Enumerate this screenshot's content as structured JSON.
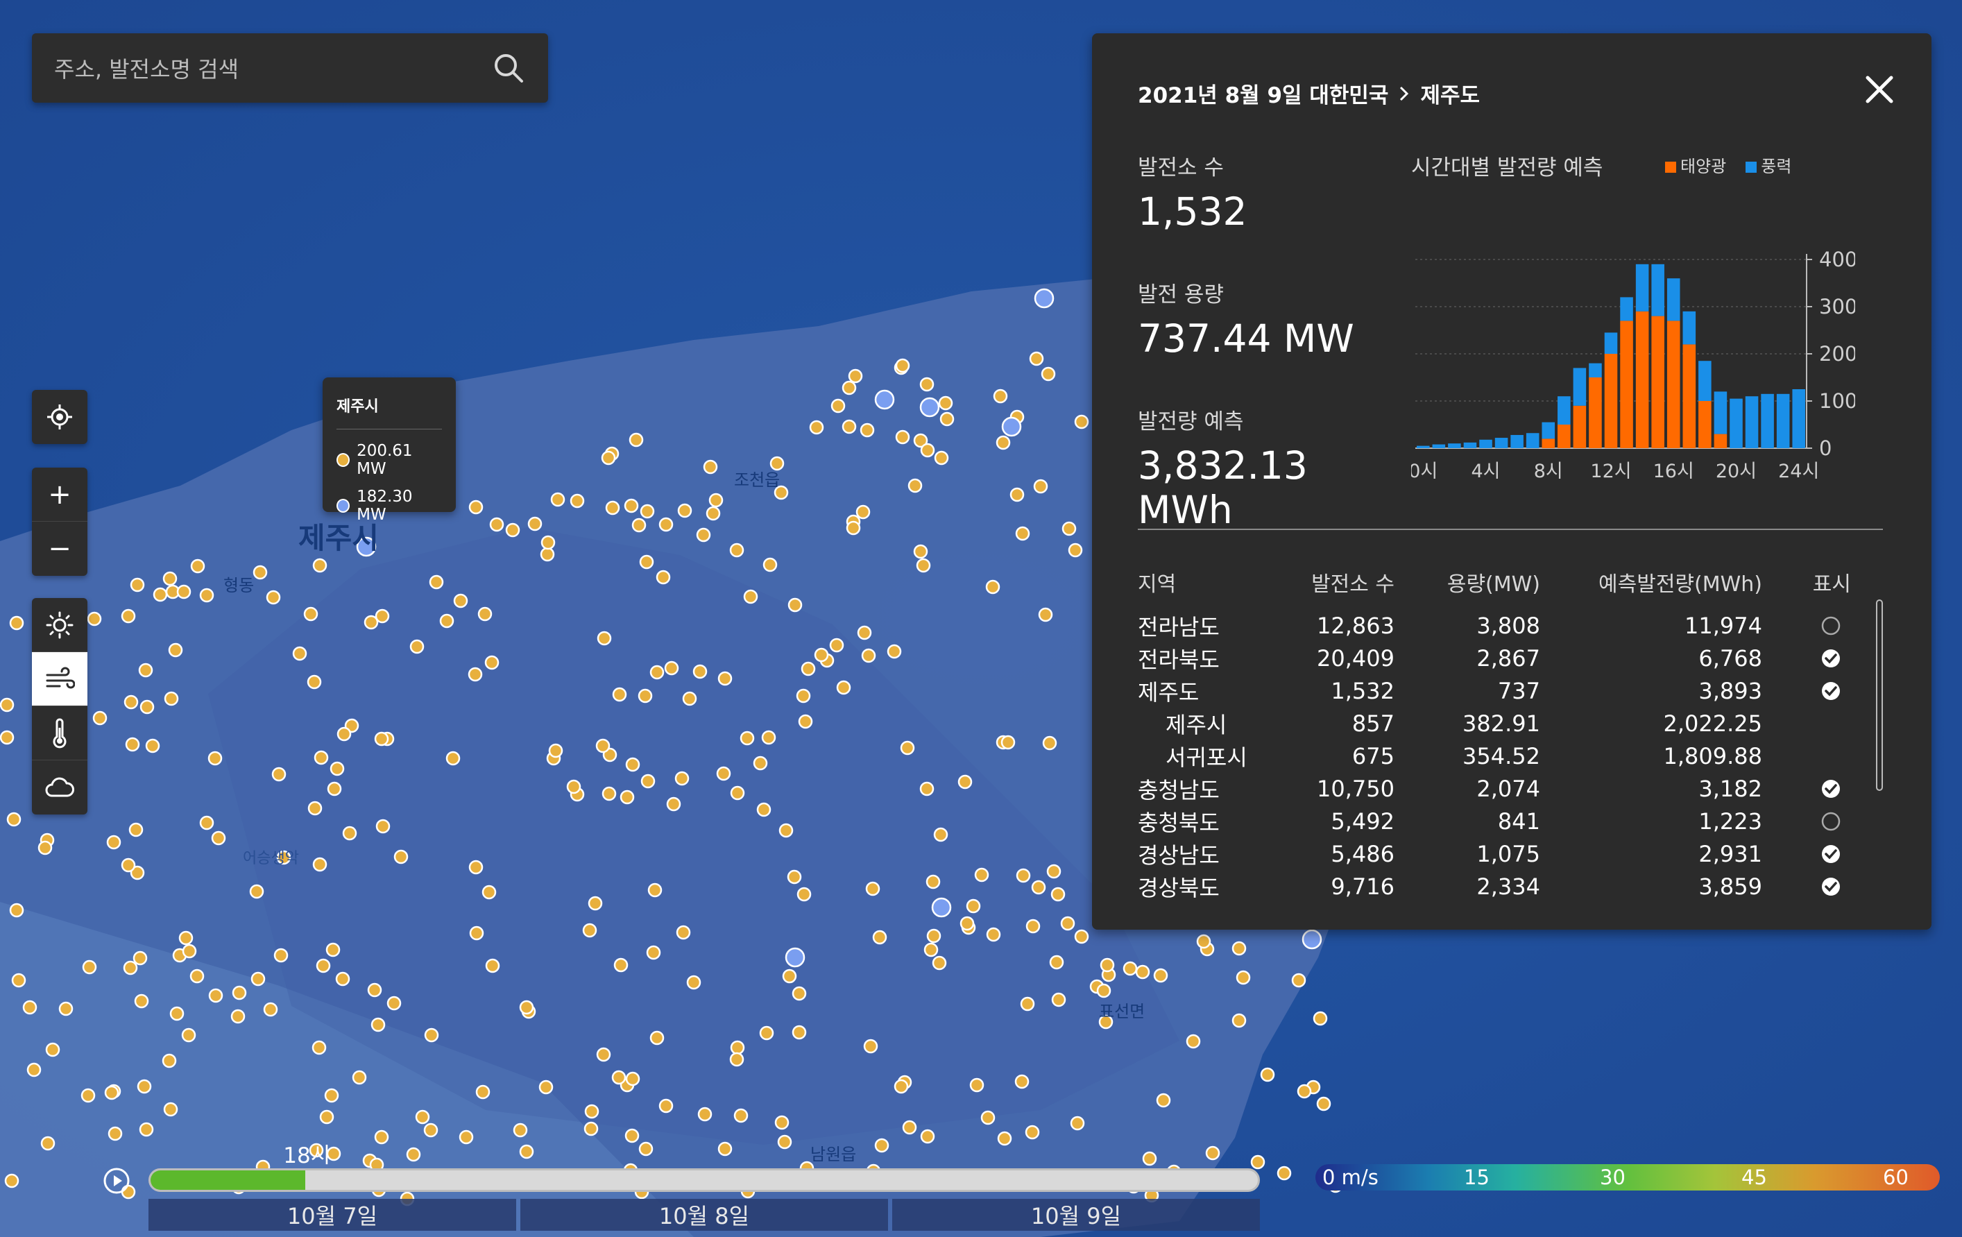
{
  "search": {
    "placeholder": "주소, 발전소명 검색",
    "icon": "search-icon"
  },
  "map_controls": {
    "locate_icon": "locate-icon",
    "zoom_in": "+",
    "zoom_out": "−",
    "layers": [
      {
        "name": "sun-icon",
        "active": false
      },
      {
        "name": "wind-icon",
        "active": true
      },
      {
        "name": "thermometer-icon",
        "active": false
      },
      {
        "name": "cloud-icon",
        "active": false
      }
    ]
  },
  "map_labels": {
    "city": "제주시",
    "place1": "조천읍",
    "place2": "형동",
    "place3": "어승생악",
    "place4": "표선면",
    "place5": "남원읍"
  },
  "tooltip": {
    "title": "제주시",
    "solar_value": "200.61 MW",
    "wind_value": "182.30 MW"
  },
  "panel": {
    "breadcrumb_date": "2021년 8월 9일 대한민국",
    "breadcrumb_region": "제주도",
    "stats": [
      {
        "label": "발전소 수",
        "value": "1,532"
      },
      {
        "label": "발전 용량",
        "value": "737.44 MW"
      },
      {
        "label": "발전량 예측",
        "value": "3,832.13 MWh"
      }
    ],
    "chart_title": "시간대별 발전량 예측",
    "legend": [
      {
        "label": "태양광",
        "color": "#ff6a00"
      },
      {
        "label": "풍력",
        "color": "#1a8fe8"
      }
    ],
    "table": {
      "headers": [
        "지역",
        "발전소 수",
        "용량(MW)",
        "예측발전량(MWh)",
        "표시"
      ],
      "rows": [
        {
          "region": "전라남도",
          "count": "12,863",
          "capacity": "3,808",
          "forecast": "11,974",
          "shown": false,
          "sub": false,
          "has_check": true
        },
        {
          "region": "전라북도",
          "count": "20,409",
          "capacity": "2,867",
          "forecast": "6,768",
          "shown": true,
          "sub": false,
          "has_check": true
        },
        {
          "region": "제주도",
          "count": "1,532",
          "capacity": "737",
          "forecast": "3,893",
          "shown": true,
          "sub": false,
          "has_check": true
        },
        {
          "region": "제주시",
          "count": "857",
          "capacity": "382.91",
          "forecast": "2,022.25",
          "shown": false,
          "sub": true,
          "has_check": false
        },
        {
          "region": "서귀포시",
          "count": "675",
          "capacity": "354.52",
          "forecast": "1,809.88",
          "shown": false,
          "sub": true,
          "has_check": false
        },
        {
          "region": "충청남도",
          "count": "10,750",
          "capacity": "2,074",
          "forecast": "3,182",
          "shown": true,
          "sub": false,
          "has_check": true
        },
        {
          "region": "충청북도",
          "count": "5,492",
          "capacity": "841",
          "forecast": "1,223",
          "shown": false,
          "sub": false,
          "has_check": true
        },
        {
          "region": "경상남도",
          "count": "5,486",
          "capacity": "1,075",
          "forecast": "2,931",
          "shown": true,
          "sub": false,
          "has_check": true
        },
        {
          "region": "경상북도",
          "count": "9,716",
          "capacity": "2,334",
          "forecast": "3,859",
          "shown": true,
          "sub": false,
          "has_check": true
        }
      ]
    }
  },
  "chart_data": {
    "type": "bar",
    "stacked": true,
    "x_tick_labels": [
      "0시",
      "4시",
      "8시",
      "12시",
      "16시",
      "20시",
      "24시"
    ],
    "y_tick_labels": [
      "0",
      "100",
      "200",
      "300",
      "400"
    ],
    "ylim": [
      0,
      400
    ],
    "hours": [
      0,
      1,
      2,
      3,
      4,
      5,
      6,
      7,
      8,
      9,
      10,
      11,
      12,
      13,
      14,
      15,
      16,
      17,
      18,
      19,
      20,
      21,
      22,
      23,
      24
    ],
    "series": [
      {
        "name": "태양광",
        "color": "#ff6a00",
        "values": [
          0,
          0,
          0,
          0,
          0,
          0,
          0,
          0,
          20,
          50,
          90,
          150,
          200,
          270,
          290,
          280,
          270,
          220,
          100,
          30,
          0,
          0,
          0,
          0,
          0
        ]
      },
      {
        "name": "풍력",
        "color": "#1a8fe8",
        "values": [
          5,
          8,
          10,
          12,
          18,
          22,
          28,
          32,
          35,
          60,
          80,
          30,
          45,
          50,
          100,
          110,
          90,
          70,
          85,
          90,
          105,
          110,
          115,
          115,
          125
        ]
      }
    ]
  },
  "timeline": {
    "play_icon": "play-icon",
    "current_time": "18시",
    "progress": 0.14,
    "days": [
      "10월 7일",
      "10월 8일",
      "10월 9일"
    ]
  },
  "wind_scale": {
    "labels": [
      "0 m/s",
      "15",
      "30",
      "45",
      "60"
    ]
  }
}
